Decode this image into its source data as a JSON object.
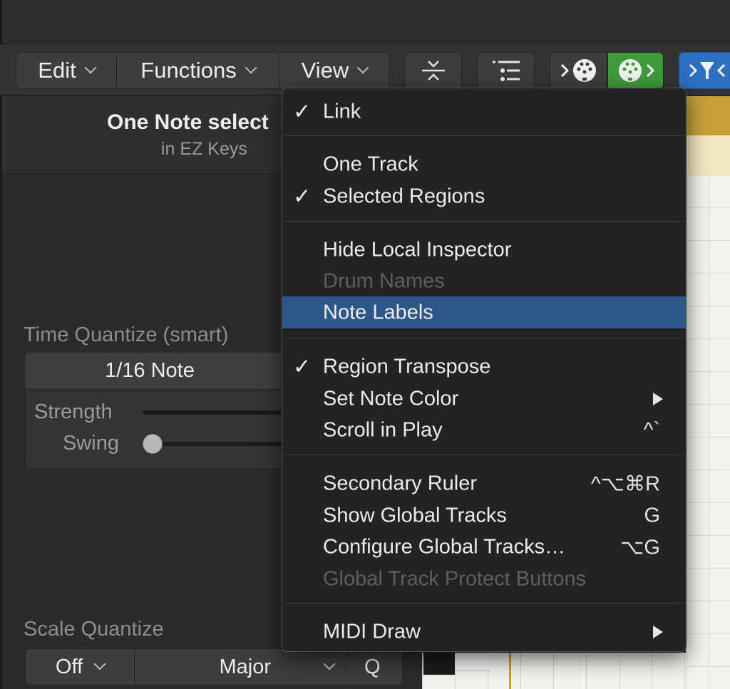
{
  "toolbar": {
    "edit_label": "Edit",
    "functions_label": "Functions",
    "view_label": "View"
  },
  "inspector": {
    "selection_title": "One Note select",
    "selection_sub": "in EZ Keys",
    "time_quantize_label": "Time Quantize (smart)",
    "time_quantize_value": "1/16 Note",
    "strength_label": "Strength",
    "swing_label": "Swing",
    "scale_quantize_label": "Scale Quantize",
    "scale_off": "Off",
    "scale_mode": "Major",
    "q_button": "Q"
  },
  "view_menu": {
    "items": [
      {
        "label": "Link",
        "checked": true
      },
      {
        "label": "One Track",
        "checked": false
      },
      {
        "label": "Selected Regions",
        "checked": true
      },
      {
        "label": "Hide Local Inspector",
        "checked": false
      },
      {
        "label": "Drum Names",
        "disabled": true
      },
      {
        "label": "Note Labels",
        "highlighted": true
      },
      {
        "label": "Region Transpose",
        "checked": true
      },
      {
        "label": "Set Note Color",
        "submenu": true
      },
      {
        "label": "Scroll in Play",
        "shortcut": "^`"
      },
      {
        "label": "Secondary Ruler",
        "shortcut": "^⌥⌘R"
      },
      {
        "label": "Show Global Tracks",
        "shortcut": "G"
      },
      {
        "label": "Configure Global Tracks…",
        "shortcut": "⌥G"
      },
      {
        "label": "Global Track Protect Buttons",
        "disabled": true
      },
      {
        "label": "MIDI Draw",
        "submenu": true
      }
    ],
    "check_glyph": "✓"
  },
  "colors": {
    "highlight": "#2d5789",
    "green_button": "#3f9a3b",
    "blue_button": "#2d6fc0",
    "region_gold": "#c7a03a"
  }
}
